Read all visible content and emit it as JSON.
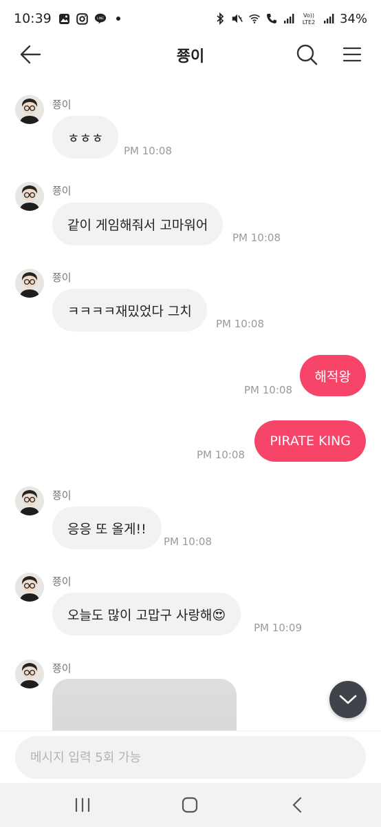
{
  "status_bar": {
    "time": "10:39",
    "battery": "34%",
    "left_icons": [
      "gallery-icon",
      "instagram-icon",
      "line-icon",
      "dot-icon"
    ],
    "right_icons": [
      "bluetooth-icon",
      "mute-icon",
      "wifi-icon",
      "call-icon",
      "signal-icon",
      "volte-icon",
      "signal-icon"
    ],
    "volte_label": "Vo)) LTE2"
  },
  "header": {
    "title": "쭁이",
    "back_icon": "arrow-left-icon",
    "search_icon": "search-icon",
    "menu_icon": "hamburger-menu-icon"
  },
  "messages": [
    {
      "sender": "쭁이",
      "text": "ㅎㅎㅎ",
      "time": "PM 10:08",
      "direction": "in"
    },
    {
      "sender": "쭁이",
      "text": "같이 게임해줘서 고마워어",
      "time": "PM 10:08",
      "direction": "in"
    },
    {
      "sender": "쭁이",
      "text": "ㅋㅋㅋㅋ재밌었다 그치",
      "time": "PM 10:08",
      "direction": "in"
    },
    {
      "text": "해적왕",
      "time": "PM 10:08",
      "direction": "out"
    },
    {
      "text": "PIRATE KING",
      "time": "PM 10:08",
      "direction": "out"
    },
    {
      "sender": "쭁이",
      "text": "응응 또 올게!!",
      "time": "PM 10:08",
      "direction": "in"
    },
    {
      "sender": "쭁이",
      "text": "오늘도 많이 고맙구 사랑해😍",
      "time": "PM 10:09",
      "direction": "in"
    },
    {
      "sender": "쭁이",
      "type": "image",
      "direction": "in"
    }
  ],
  "scroll_button": {
    "icon": "chevron-down-icon"
  },
  "input": {
    "placeholder": "메시지 입력 5회 가능",
    "value": ""
  },
  "nav_bar": {
    "recents_icon": "recents-icon",
    "home_icon": "home-icon",
    "back_icon": "nav-back-icon"
  },
  "colors": {
    "accent": "#f7456a",
    "bubble_in": "#f2f2f4",
    "fab": "#3f434a"
  }
}
